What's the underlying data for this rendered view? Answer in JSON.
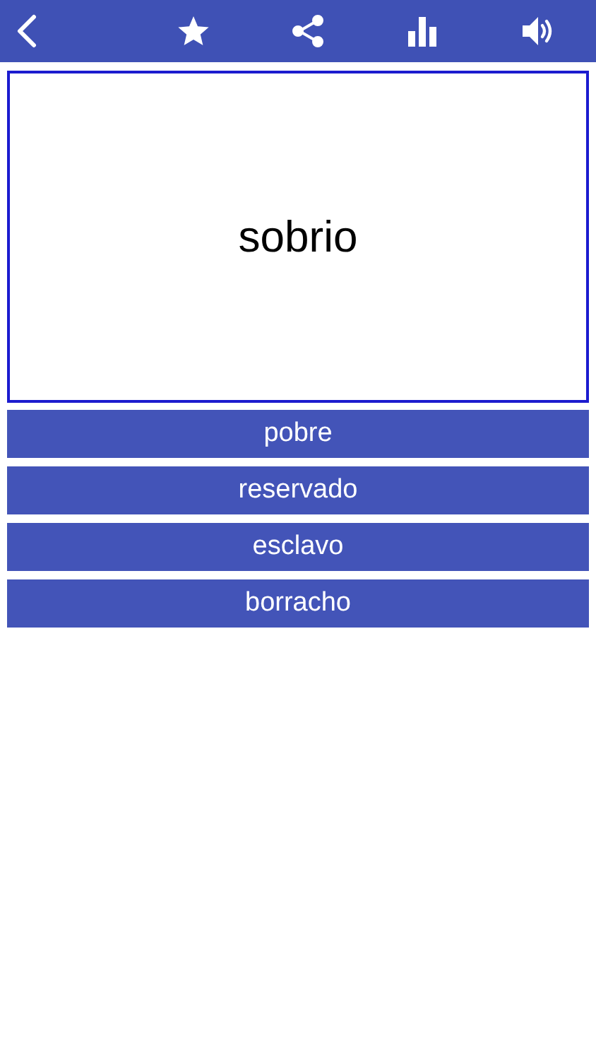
{
  "card": {
    "word": "sobrio"
  },
  "options": [
    {
      "label": "pobre"
    },
    {
      "label": "reservado"
    },
    {
      "label": "esclavo"
    },
    {
      "label": "borracho"
    }
  ]
}
